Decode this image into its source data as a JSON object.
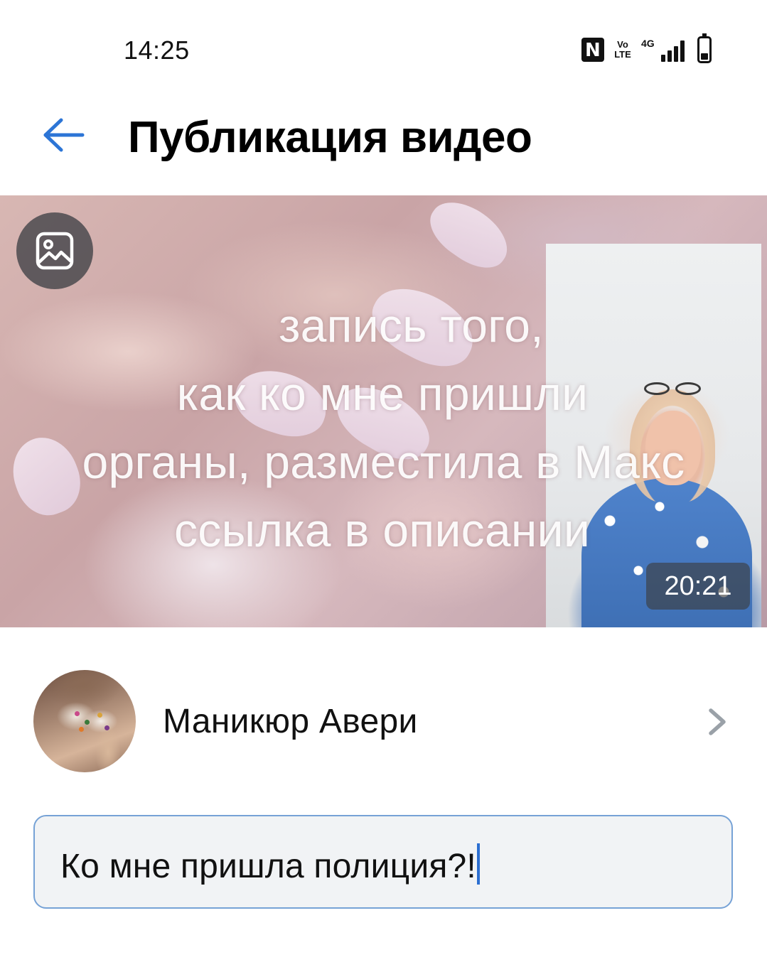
{
  "status_bar": {
    "time": "14:25",
    "icons": [
      "nfc-icon",
      "volte-icon",
      "signal-4g-icon",
      "battery-icon"
    ],
    "volte_label_top": "Vo",
    "volte_label_bottom": "LTE",
    "network_label": "4G"
  },
  "header": {
    "title": "Публикация видео",
    "back_icon": "arrow-left-icon",
    "accent_color": "#2c75d6"
  },
  "video": {
    "overlay_lines": [
      "запись того,",
      "как ко мне пришли",
      "органы, разместила в Макс",
      "ссылка в описании"
    ],
    "duration": "20:21",
    "gallery_icon": "image-icon"
  },
  "channel": {
    "name": "Маникюр Авери",
    "chevron_icon": "chevron-right-icon"
  },
  "title_field": {
    "value": "Ко мне пришла полиция?!",
    "border_color": "#76a2d6"
  }
}
